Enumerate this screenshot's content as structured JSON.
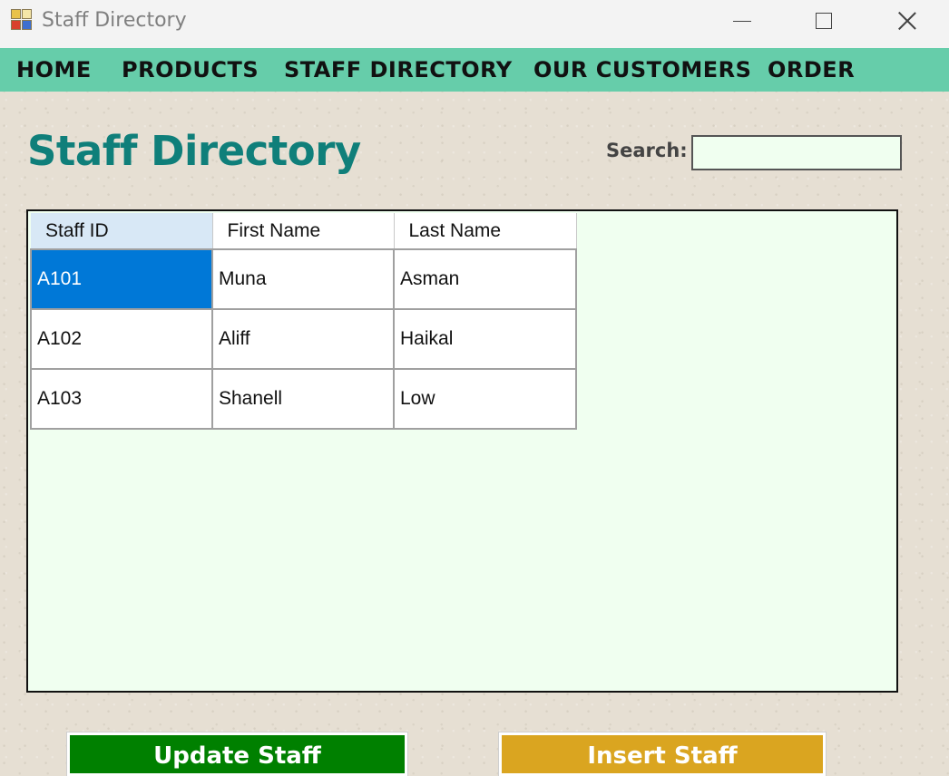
{
  "window": {
    "title": "Staff Directory"
  },
  "menu": {
    "items": [
      {
        "label": "HOME"
      },
      {
        "label": "PRODUCTS"
      },
      {
        "label": "STAFF DIRECTORY"
      },
      {
        "label": "OUR CUSTOMERS"
      },
      {
        "label": "ORDER"
      }
    ]
  },
  "page": {
    "title": "Staff Directory"
  },
  "search": {
    "label": "Search:",
    "value": ""
  },
  "table": {
    "columns": [
      "Staff ID",
      "First Name",
      "Last Name"
    ],
    "rows": [
      [
        "A101",
        "Muna",
        "Asman"
      ],
      [
        "A102",
        "Aliff",
        "Haikal"
      ],
      [
        "A103",
        "Shanell",
        "Low"
      ]
    ],
    "selected_row": 0
  },
  "buttons": {
    "update_label": "Update Staff",
    "insert_label": "Insert Staff"
  },
  "colors": {
    "menu_bar": "#66cdaa",
    "title": "#0f7f7a",
    "update_button": "#008000",
    "insert_button": "#daa520",
    "selection": "#0078d7"
  }
}
